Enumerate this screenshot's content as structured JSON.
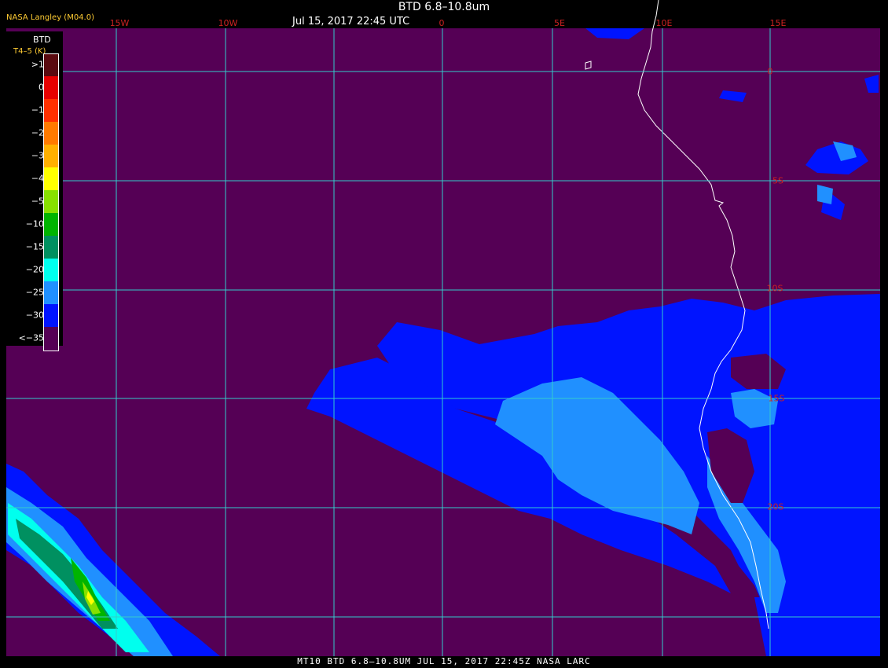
{
  "header": {
    "title": "BTD 6.8–10.8um",
    "datetime": "Jul 15, 2017 22:45 UTC",
    "source": "NASA Langley (M04.0)"
  },
  "legend": {
    "title": "BTD",
    "subtitle": "T4–5 (K)",
    "items": [
      {
        "label": ">1",
        "color": "#5a0a10"
      },
      {
        "label": "0",
        "color": "#e60000"
      },
      {
        "label": "−1",
        "color": "#ff3000"
      },
      {
        "label": "−2",
        "color": "#ff7a00"
      },
      {
        "label": "−3",
        "color": "#ffb000"
      },
      {
        "label": "−4",
        "color": "#ffff00"
      },
      {
        "label": "−5",
        "color": "#88e000"
      },
      {
        "label": "−10",
        "color": "#00b400"
      },
      {
        "label": "−15",
        "color": "#009060"
      },
      {
        "label": "−20",
        "color": "#00ffee"
      },
      {
        "label": "−25",
        "color": "#2090ff"
      },
      {
        "label": "−30",
        "color": "#0014ff"
      },
      {
        "label": "<−35",
        "color": "#550055"
      }
    ]
  },
  "lon_labels": [
    "15W",
    "10W",
    "0",
    "5E",
    "10E",
    "15E"
  ],
  "lat_labels": [
    "0",
    "5S",
    "10S",
    "15S",
    "20S"
  ],
  "footer": "MT10  BTD 6.8–10.8UM   JUL 15, 2017 22:45Z   NASA LARC",
  "colors": {
    "background": "#550055",
    "grid": "#33cccc",
    "coast": "#ffffff"
  }
}
